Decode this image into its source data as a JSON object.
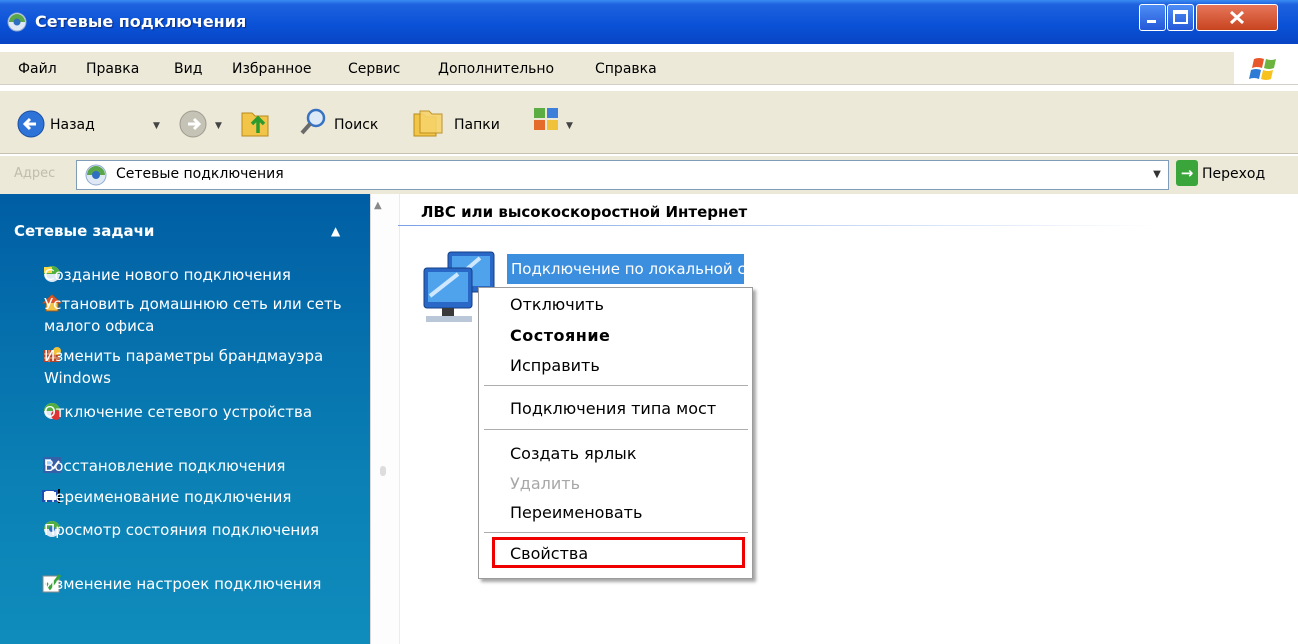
{
  "window": {
    "title": "Сетевые подключения",
    "icons": {
      "title": "network-connections-icon"
    }
  },
  "menubar": {
    "items": [
      "Файл",
      "Правка",
      "Вид",
      "Избранное",
      "Сервис",
      "Дополнительно",
      "Справка"
    ]
  },
  "toolbar": {
    "back_label": "Назад",
    "search_label": "Поиск",
    "folders_label": "Папки"
  },
  "address": {
    "label": "Адрес",
    "value": "Сетевые подключения",
    "go_label": "Переход"
  },
  "tasks": {
    "header": "Сетевые задачи",
    "items": [
      {
        "label": "Создание нового подключения",
        "icon": "new-connection-icon"
      },
      {
        "label": "Установить домашнюю сеть или сеть малого офиса",
        "icon": "home-network-icon"
      },
      {
        "label": "Изменить параметры брандмауэра Windows",
        "icon": "firewall-icon"
      },
      {
        "label": "Отключение сетевого устройства",
        "icon": "disable-device-icon"
      },
      {
        "label": "Восстановление подключения",
        "icon": "repair-connection-icon"
      },
      {
        "label": "Переименование подключения",
        "icon": "rename-connection-icon"
      },
      {
        "label": "Просмотр состояния подключения",
        "icon": "status-icon"
      },
      {
        "label": "Изменение настроек подключения",
        "icon": "settings-check-icon"
      }
    ]
  },
  "content": {
    "group_title": "ЛВС или высокоскоростной Интернет",
    "connection_label": "Подключение по локальной сети"
  },
  "context_menu": {
    "items": [
      {
        "label": "Отключить",
        "state": "normal"
      },
      {
        "label": "Состояние",
        "state": "default"
      },
      {
        "label": "Исправить",
        "state": "normal"
      },
      {
        "label": "Подключения типа мост",
        "state": "normal"
      },
      {
        "label": "Создать ярлык",
        "state": "normal"
      },
      {
        "label": "Удалить",
        "state": "disabled"
      },
      {
        "label": "Переименовать",
        "state": "normal"
      },
      {
        "label": "Свойства",
        "state": "highlighted"
      }
    ]
  },
  "colors": {
    "titlebar": "#0a52d8",
    "task_pane": "#0a7fb4",
    "selection": "#3c8fde",
    "highlight_box": "#e00000"
  }
}
